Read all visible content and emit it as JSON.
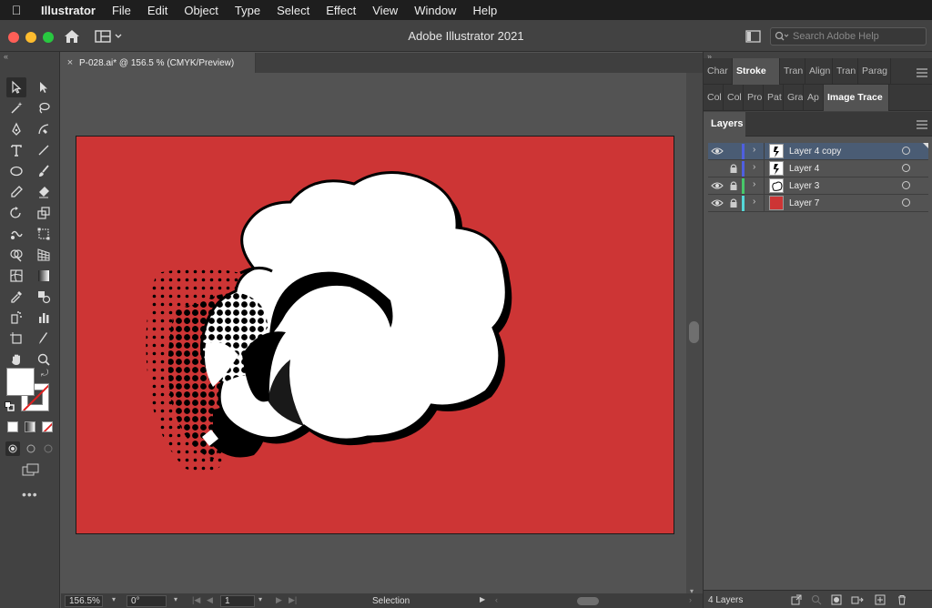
{
  "menubar": {
    "app_name": "Illustrator",
    "items": [
      "File",
      "Edit",
      "Object",
      "Type",
      "Select",
      "Effect",
      "View",
      "Window",
      "Help"
    ]
  },
  "window": {
    "title": "Adobe Illustrator 2021",
    "search_placeholder": "Search Adobe Help"
  },
  "document": {
    "tab_title": "P-028.ai* @ 156.5 % (CMYK/Preview)"
  },
  "statusbar": {
    "zoom": "156.5%",
    "rotation": "0°",
    "artboard_number": "1",
    "mode": "Selection"
  },
  "panels": {
    "top_tabs": [
      "Char",
      "Stroke",
      "Tran",
      "Align",
      "Tran",
      "Parag"
    ],
    "active_top_tab": "Stroke",
    "second_tabs": [
      "Col",
      "Col",
      "Pro",
      "Pat",
      "Gra",
      "Ap",
      "Image Trace"
    ],
    "active_second_tab": "Image Trace",
    "layers_title": "Layers"
  },
  "layers": [
    {
      "name": "Layer 4 copy",
      "visible": true,
      "locked": false,
      "color": "#4f5fe0",
      "selected": true
    },
    {
      "name": "Layer 4",
      "visible": false,
      "locked": true,
      "color": "#4f5fe0",
      "selected": false
    },
    {
      "name": "Layer 3",
      "visible": true,
      "locked": true,
      "color": "#48c86a",
      "selected": false
    },
    {
      "name": "Layer 7",
      "visible": true,
      "locked": true,
      "color": "#54d8d8",
      "selected": false
    }
  ],
  "layers_footer": {
    "count": "4 Layers"
  },
  "colors": {
    "artboard_bg": "#cd3535",
    "accent": "#4a5c74"
  }
}
